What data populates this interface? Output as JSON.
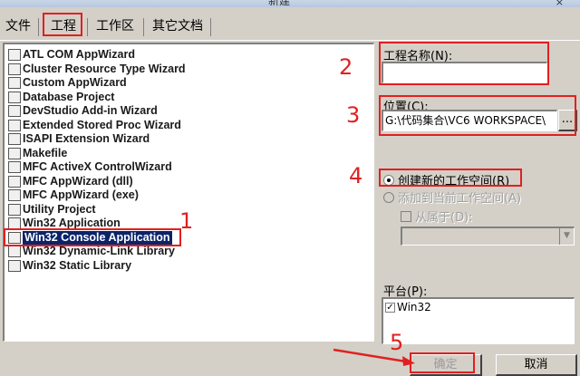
{
  "window": {
    "title": "新建",
    "close_glyph": "×"
  },
  "tabs": [
    {
      "label": "文件"
    },
    {
      "label": "工程"
    },
    {
      "label": "工作区"
    },
    {
      "label": "其它文档"
    }
  ],
  "projects": [
    {
      "label": "ATL COM AppWizard"
    },
    {
      "label": "Cluster Resource Type Wizard"
    },
    {
      "label": "Custom AppWizard"
    },
    {
      "label": "Database Project"
    },
    {
      "label": "DevStudio Add-in Wizard"
    },
    {
      "label": "Extended Stored Proc Wizard"
    },
    {
      "label": "ISAPI Extension Wizard"
    },
    {
      "label": "Makefile"
    },
    {
      "label": "MFC ActiveX ControlWizard"
    },
    {
      "label": "MFC AppWizard (dll)"
    },
    {
      "label": "MFC AppWizard (exe)"
    },
    {
      "label": "Utility Project"
    },
    {
      "label": "Win32 Application"
    },
    {
      "label": "Win32 Console Application",
      "selected": true
    },
    {
      "label": "Win32 Dynamic-Link Library"
    },
    {
      "label": "Win32 Static Library"
    }
  ],
  "form": {
    "project_name_label": "工程名称(N):",
    "project_name_value": "",
    "location_label": "位置(C):",
    "location_value": "G:\\代码集合\\VC6 WORKSPACE\\",
    "browse_label": "...",
    "create_new_workspace_label": "创建新的工作空间(R)",
    "add_to_workspace_label": "添加到当前工作空间(A)",
    "dependent_label": "从属于(D):",
    "platform_label": "平台(P):",
    "platform_item": "Win32",
    "platform_check": "✓"
  },
  "buttons": {
    "ok": "确定",
    "cancel": "取消"
  },
  "annotations": [
    "1",
    "2",
    "3",
    "4",
    "5"
  ],
  "colors": {
    "annotation_red": "#e02020",
    "selection_blue": "#0a246a",
    "dialog_gray": "#d4d0c8"
  }
}
